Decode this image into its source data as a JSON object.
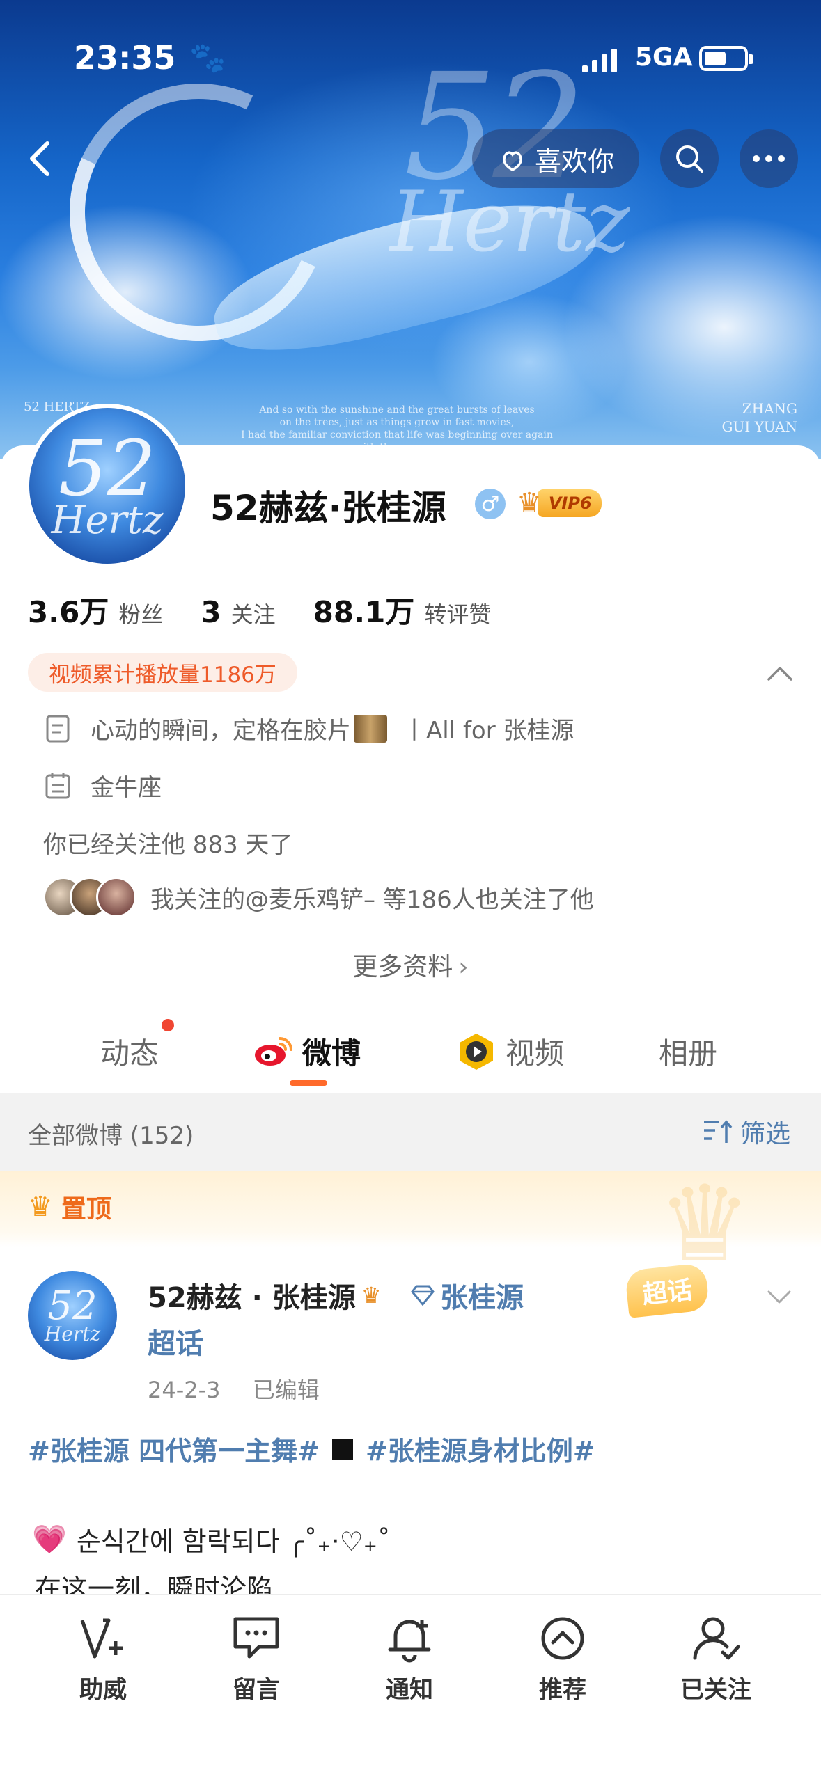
{
  "status_bar": {
    "time": "23:35",
    "paw_icon": "paw-icon",
    "network": "5GA"
  },
  "banner": {
    "art_52": "52",
    "art_hertz": "Hertz",
    "caption_line1": "And so with the sunshine and the great bursts of leaves",
    "caption_line2": "on the trees, just as things grow in fast movies,",
    "caption_line3": "I had the familiar conviction that life was beginning over again with the summer",
    "corner_left": "52 HERTZ",
    "corner_right_1": "ZHANG",
    "corner_right_2": "GUI YUAN"
  },
  "nav": {
    "like_label": "喜欢你"
  },
  "profile": {
    "avatar_text_1": "52",
    "avatar_text_2": "Hertz",
    "name": "52赫兹·张桂源",
    "gender_symbol": "♂",
    "vip_label": "VIP6",
    "stats": [
      {
        "num": "3.6万",
        "label": "粉丝"
      },
      {
        "num": "3",
        "label": "关注"
      },
      {
        "num": "88.1万",
        "label": "转评赞"
      }
    ],
    "play_count": "视频累计播放量1186万",
    "bio_before": "心动的瞬间，定格在胶片",
    "bio_after": "丨All for 张桂源",
    "sign": "金牛座",
    "follow_days": "你已经关注他 883 天了",
    "mutual": "我关注的@麦乐鸡铲– 等186人也关注了他",
    "more_info": "更多资料"
  },
  "tabs": {
    "dongtai": "动态",
    "weibo": "微博",
    "video": "视频",
    "album": "相册"
  },
  "filter": {
    "title": "全部微博 (152)",
    "button": "筛选"
  },
  "pinned": {
    "label": "置顶"
  },
  "post": {
    "avatar_text_1": "52",
    "avatar_text_2": "Hertz",
    "author": "52赫兹 · 张桂源",
    "topic": "张桂源",
    "topic_suffix": "超话",
    "date": "24-2-3",
    "edited": "已编辑",
    "badge": "超话",
    "hashtag1": "#张桂源 四代第一主舞#",
    "hashtag2": "#张桂源身材比例#",
    "line1": "순식간에 함락되다 ╭˚₊‧♡₊˚",
    "line2": "在这一刻，瞬时沦陷"
  },
  "bottom_bar": [
    {
      "label": "助威",
      "icon": "cheer-icon"
    },
    {
      "label": "留言",
      "icon": "message-icon"
    },
    {
      "label": "通知",
      "icon": "bell-plus-icon"
    },
    {
      "label": "推荐",
      "icon": "recommend-icon"
    },
    {
      "label": "已关注",
      "icon": "user-check-icon"
    }
  ],
  "colors": {
    "accent_orange": "#ff6a2b",
    "link_blue": "#507daf",
    "play_tag_text": "#ee5b2a"
  }
}
